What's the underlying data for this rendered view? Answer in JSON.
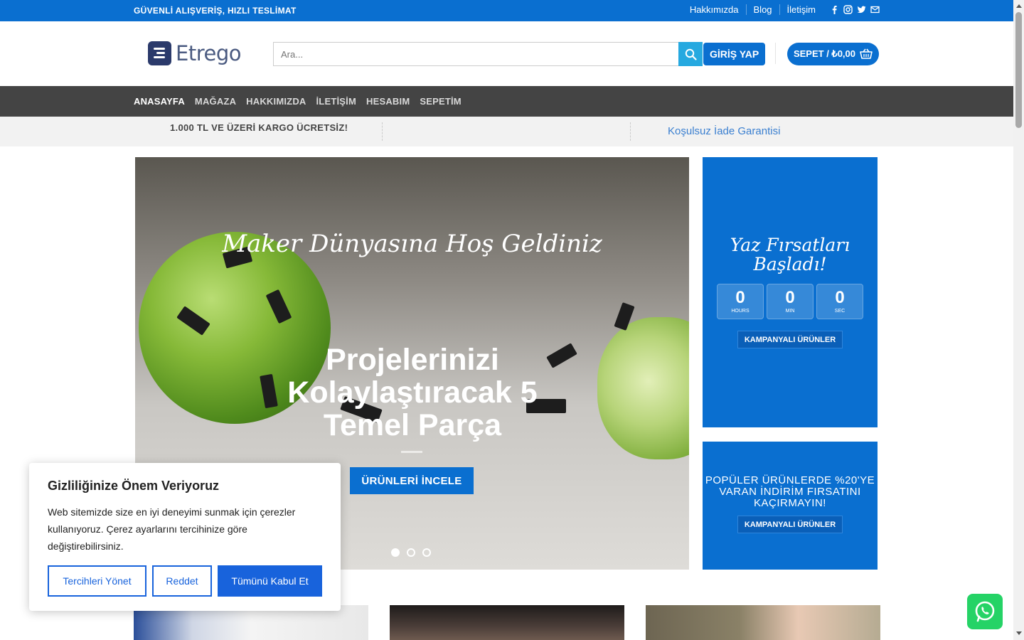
{
  "topbar": {
    "tagline": "GÜVENLİ ALIŞVERİŞ, HIZLI TESLİMAT",
    "links": [
      "Hakkımızda",
      "Blog",
      "İletişim"
    ],
    "social_icons": [
      "facebook-icon",
      "instagram-icon",
      "twitter-icon",
      "mail-icon"
    ]
  },
  "header": {
    "logo_text": "Etrego",
    "search_placeholder": "Ara...",
    "login_label": "GİRİŞ YAP",
    "cart_label": "SEPET / ₺0,00"
  },
  "nav": {
    "items": [
      "ANASAYFA",
      "MAĞAZA",
      "HAKKIMIZDA",
      "İLETİŞİM",
      "HESABIM",
      "SEPETİM"
    ]
  },
  "infobar": {
    "msg1": "1.000 TL VE ÜZERİ KARGO ÜCRETSİZ!",
    "msg2": "Koşulsuz İade Garantisi"
  },
  "hero": {
    "script_title": "Maker Dünyasına Hoş Geldiniz",
    "headline": "Projelerinizi Kolaylaştıracak 5 Temel Parça",
    "cta_label": "ÜRÜNLERİ İNCELE",
    "slide_count": 3,
    "active_slide": 1
  },
  "promo1": {
    "title": "Yaz Fırsatları Başladı!",
    "countdown": [
      {
        "value": "0",
        "label": "HOURS"
      },
      {
        "value": "0",
        "label": "MIN"
      },
      {
        "value": "0",
        "label": "SEC"
      }
    ],
    "button_label": "KAMPANYALI ÜRÜNLER"
  },
  "promo2": {
    "text": "POPÜLER ÜRÜNLERDE %20'YE VARAN İNDİRİM FIRSATINI KAÇIRMAYIN!",
    "button_label": "KAMPANYALI ÜRÜNLER"
  },
  "cookie": {
    "title": "Gizliliğinize Önem Veriyoruz",
    "text": "Web sitemizde size en iyi deneyimi sunmak için çerezler kullanıyoruz. Çerez ayarlarını tercihinize göre değiştirebilirsiniz.",
    "manage_label": "Tercihleri Yönet",
    "reject_label": "Reddet",
    "accept_label": "Tümünü Kabul Et"
  },
  "colors": {
    "primary": "#0a6fd0",
    "nav_bg": "#444444",
    "search_button": "#26a9e0",
    "whatsapp": "#25d366"
  }
}
